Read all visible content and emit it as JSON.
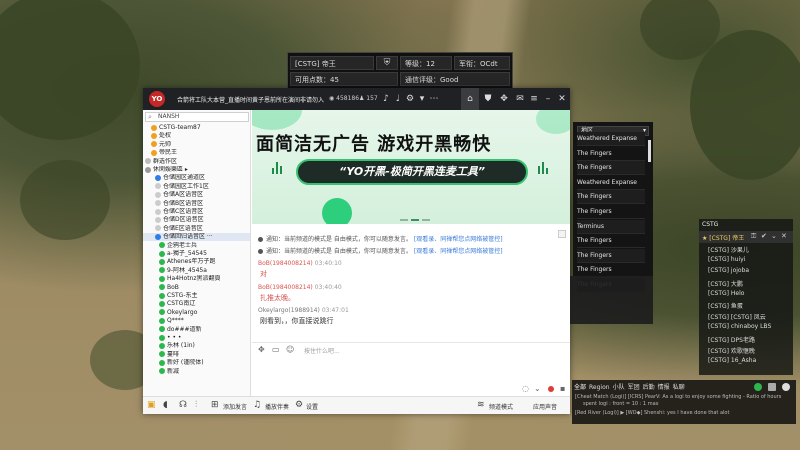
{
  "stat_box": {
    "player": "[CSTG] 帝王",
    "level_label": "等级：",
    "level_value": "12",
    "military_rank_label": "军衔：",
    "military_rank_value": "OCdt",
    "points_label": "可用点数：",
    "points_value": "45",
    "comm_label": "通信评级：",
    "comm_value": "Good"
  },
  "window": {
    "title": "合箭将工队大本营_直播时间黄子恩前所在演间非请勿入",
    "online_count": "458186",
    "member_count": "157",
    "colors": {
      "titlebar": "#202124",
      "accent": "#36c272"
    }
  },
  "tree": {
    "search_text": "NANSH",
    "rows": [
      {
        "text": "CSTG-team87",
        "icon": "#f0a020"
      },
      {
        "text": "处权",
        "icon": "#f0a020"
      },
      {
        "text": "元帅",
        "icon": "#f0a020"
      },
      {
        "text": "帝民王",
        "icon": "#f0a020"
      },
      {
        "text": "群选作区",
        "icon": "#bbbbbb"
      },
      {
        "text": "休閑娛樂區 ▸",
        "icon": "#999999"
      },
      {
        "text": "仓储园区通道区",
        "icon": "#2e7de9"
      },
      {
        "text": "仓储园区工作1区",
        "icon": "#cccccc"
      },
      {
        "text": "仓储A区语音区",
        "icon": "#cccccc"
      },
      {
        "text": "仓储B区语音区",
        "icon": "#cccccc"
      },
      {
        "text": "仓储C区语音区",
        "icon": "#cccccc"
      },
      {
        "text": "仓储D区语音区",
        "icon": "#cccccc"
      },
      {
        "text": "仓储E区语音区",
        "icon": "#cccccc"
      },
      {
        "text": "仓储回归语音区 ···",
        "icon": "#2e7de9"
      },
      {
        "text": "企鸦老士兵",
        "icon": "#2db84d"
      },
      {
        "text": "a-獨子_54545",
        "icon": "#2db84d"
      },
      {
        "text": "Athenes年万子跑",
        "icon": "#2db84d"
      },
      {
        "text": "9-阿林_4545a",
        "icon": "#2db84d"
      },
      {
        "text": "Ha4Hotnz黑派翻頁",
        "icon": "#2db84d"
      },
      {
        "text": "BoB",
        "icon": "#2db84d"
      },
      {
        "text": "CSTG-东主",
        "icon": "#2db84d"
      },
      {
        "text": "CSTG南辽",
        "icon": "#2db84d"
      },
      {
        "text": "Okeylargo",
        "icon": "#2db84d"
      },
      {
        "text": "Q****",
        "icon": "#2db84d"
      },
      {
        "text": "do###道新",
        "icon": "#2db84d"
      },
      {
        "text": "• • •",
        "icon": "#2db84d"
      },
      {
        "text": "乐林 (1in)",
        "icon": "#2db84d"
      },
      {
        "text": "蔓啡",
        "icon": "#2db84d"
      },
      {
        "text": "新好 (谨院体)",
        "icon": "#2db84d"
      },
      {
        "text": "新减",
        "icon": "#2db84d"
      }
    ]
  },
  "banner": {
    "headline": "面简洁无广告  游戏开黑畅快",
    "pill": "“YO开黑-极简开黑连麦工具”"
  },
  "chat": {
    "system_messages": [
      {
        "prefix": "通知：",
        "text": "当前频道的模式是 自由模式，你可以随意发言。",
        "link": "[观看录、同禅帮您点网络被管控]"
      },
      {
        "prefix": "通知：",
        "text": "当前频道的模式是 自由模式，你可以随意发言。",
        "link": "[观看录、同禅帮您点网络被管控]"
      }
    ],
    "messages": [
      {
        "user": "BoB(1984008214)",
        "time": "03:40:10",
        "text": "对",
        "color": "#d9534f"
      },
      {
        "user": "BoB(1984008214)",
        "time": "03:40:40",
        "text": "扎推太晚。",
        "color": "#d9534f"
      },
      {
        "user": "Okeylargo(1988914)",
        "time": "03:47:01",
        "text": "刚看到，，你直接说跳行",
        "color": "#777777"
      }
    ],
    "input_placeholder": "按住什么吧..."
  },
  "bottombar": {
    "add_channel": "添加发言",
    "play_music": "播放伴奏",
    "settings": "设置",
    "channel_settings": "频道模式",
    "apply": "应用声音"
  },
  "channel_list": {
    "header": "地区",
    "items": [
      "Weathered Expanse",
      "The Fingers",
      "The Fingers",
      "Weathered Expanse",
      "The Fingers",
      "The Fingers",
      "Terminus",
      "The Fingers",
      "The Fingers",
      "The Fingers",
      "The Fingers"
    ]
  },
  "members": {
    "header": "CSTG",
    "self": "[CSTG] 帝王",
    "list": [
      "[CSTG] 沙果儿",
      "[CSTG] huiyi",
      "[CSTG] jojoba",
      "[CSTG] 大鹏",
      "[CSTG] Helo",
      "[CSTG] 鱼蛋",
      "[CSTG] [CSTG] 凤云",
      "[CSTG] chinaboy LBS",
      "[CSTG] DPS老路",
      "[CSTG] 欢歌惬晚",
      "[CSTG] 16_Asha"
    ]
  },
  "game_chat": {
    "tabs": [
      "全部",
      "Region",
      "小队",
      "军团",
      "后勤",
      "情报",
      "私聊"
    ],
    "lines": [
      "[Cheat Match (Logi)] [ICRS] PearV: As a logi to enjoy some fighting - Ratio of hours",
      "spent logi : front = 10 : 1 max",
      "[Red River (Logi)] ▶ [WO◆] Shenshi: yes I have done that alot"
    ]
  }
}
